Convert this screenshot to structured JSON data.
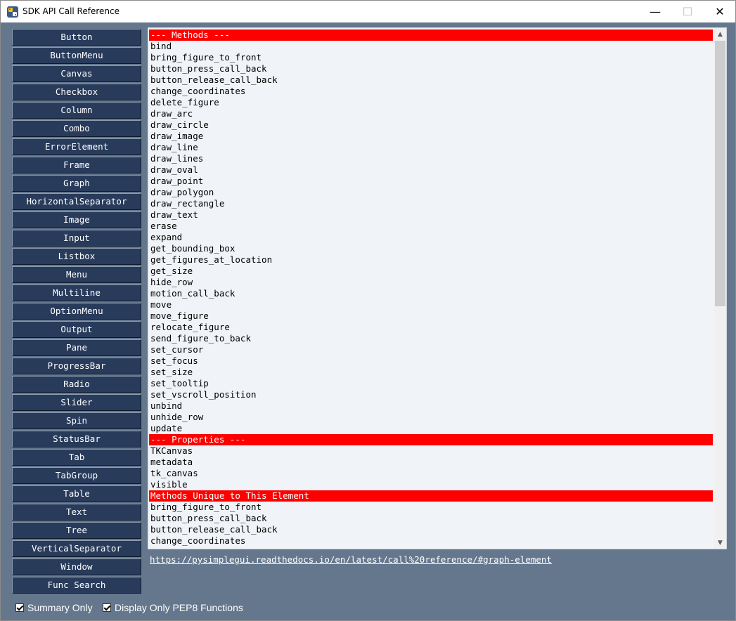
{
  "window": {
    "title": "SDK API Call Reference",
    "controls": {
      "minimize": "—",
      "maximize": "☐",
      "close": "✕"
    }
  },
  "element_buttons": [
    "Button",
    "ButtonMenu",
    "Canvas",
    "Checkbox",
    "Column",
    "Combo",
    "ErrorElement",
    "Frame",
    "Graph",
    "HorizontalSeparator",
    "Image",
    "Input",
    "Listbox",
    "Menu",
    "Multiline",
    "OptionMenu",
    "Output",
    "Pane",
    "ProgressBar",
    "Radio",
    "Slider",
    "Spin",
    "StatusBar",
    "Tab",
    "TabGroup",
    "Table",
    "Text",
    "Tree",
    "VerticalSeparator",
    "Window",
    "Func Search"
  ],
  "listbox": {
    "rows": [
      {
        "text": "--- Methods ---",
        "header": true
      },
      {
        "text": "bind"
      },
      {
        "text": "bring_figure_to_front"
      },
      {
        "text": "button_press_call_back"
      },
      {
        "text": "button_release_call_back"
      },
      {
        "text": "change_coordinates"
      },
      {
        "text": "delete_figure"
      },
      {
        "text": "draw_arc"
      },
      {
        "text": "draw_circle"
      },
      {
        "text": "draw_image"
      },
      {
        "text": "draw_line"
      },
      {
        "text": "draw_lines"
      },
      {
        "text": "draw_oval"
      },
      {
        "text": "draw_point"
      },
      {
        "text": "draw_polygon"
      },
      {
        "text": "draw_rectangle"
      },
      {
        "text": "draw_text"
      },
      {
        "text": "erase"
      },
      {
        "text": "expand"
      },
      {
        "text": "get_bounding_box"
      },
      {
        "text": "get_figures_at_location"
      },
      {
        "text": "get_size"
      },
      {
        "text": "hide_row"
      },
      {
        "text": "motion_call_back"
      },
      {
        "text": "move"
      },
      {
        "text": "move_figure"
      },
      {
        "text": "relocate_figure"
      },
      {
        "text": "send_figure_to_back"
      },
      {
        "text": "set_cursor"
      },
      {
        "text": "set_focus"
      },
      {
        "text": "set_size"
      },
      {
        "text": "set_tooltip"
      },
      {
        "text": "set_vscroll_position"
      },
      {
        "text": "unbind"
      },
      {
        "text": "unhide_row"
      },
      {
        "text": "update"
      },
      {
        "text": "--- Properties ---",
        "header": true
      },
      {
        "text": "TKCanvas"
      },
      {
        "text": "metadata"
      },
      {
        "text": "tk_canvas"
      },
      {
        "text": "visible"
      },
      {
        "text": "Methods Unique to This Element",
        "header": true
      },
      {
        "text": "bring_figure_to_front"
      },
      {
        "text": "button_press_call_back"
      },
      {
        "text": "button_release_call_back"
      },
      {
        "text": "change_coordinates"
      }
    ],
    "header_color": "#ff0000"
  },
  "doc_link": "https://pysimplegui.readthedocs.io/en/latest/call%20reference/#graph-element",
  "checkboxes": [
    {
      "label": "Summary Only",
      "checked": true
    },
    {
      "label": "Display Only PEP8 Functions",
      "checked": true
    }
  ],
  "colors": {
    "background": "#64778d",
    "button_bg": "#283b5b",
    "button_text": "#ffffff",
    "list_bg": "#f0f3f7",
    "header_bg": "#ff0000"
  }
}
